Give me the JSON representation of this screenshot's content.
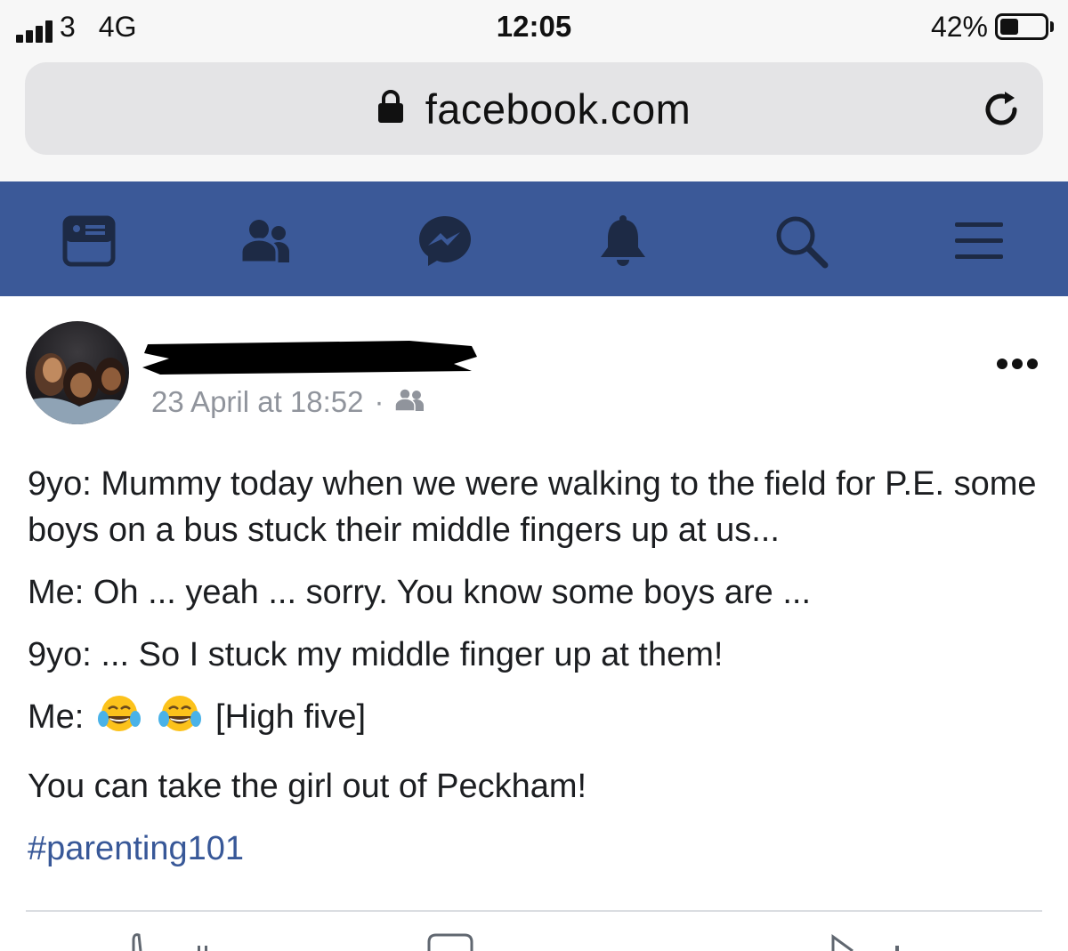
{
  "status_bar": {
    "carrier": "3",
    "network": "4G",
    "time": "12:05",
    "battery": "42%",
    "battery_level": 0.42
  },
  "browser": {
    "url": "facebook.com"
  },
  "nav": {
    "items": [
      {
        "icon": "news-feed-icon"
      },
      {
        "icon": "friends-icon"
      },
      {
        "icon": "messenger-icon"
      },
      {
        "icon": "notifications-bell-icon"
      },
      {
        "icon": "search-icon"
      },
      {
        "icon": "menu-icon"
      }
    ],
    "bar_color": "#3b5998",
    "icon_color": "#1d2a45"
  },
  "post": {
    "timestamp": "23 April at 18:52",
    "separator": "·",
    "audience_icon": "friends-audience-icon",
    "paragraphs": {
      "p1": "9yo: Mummy today when we were walking to the field for P.E. some boys on a bus stuck their middle fingers up at us...",
      "p2": "Me: Oh ... yeah ... sorry. You know some boys are ...",
      "p3": "9yo: ... So I stuck my middle finger up at them!",
      "p4_prefix": "Me:",
      "p4_suffix": "[High five]",
      "p5": "You can take the girl out of Peckham!"
    },
    "hashtag": "#parenting101",
    "hashtag_color": "#385898",
    "emoji": "tears-of-joy-emoji"
  }
}
